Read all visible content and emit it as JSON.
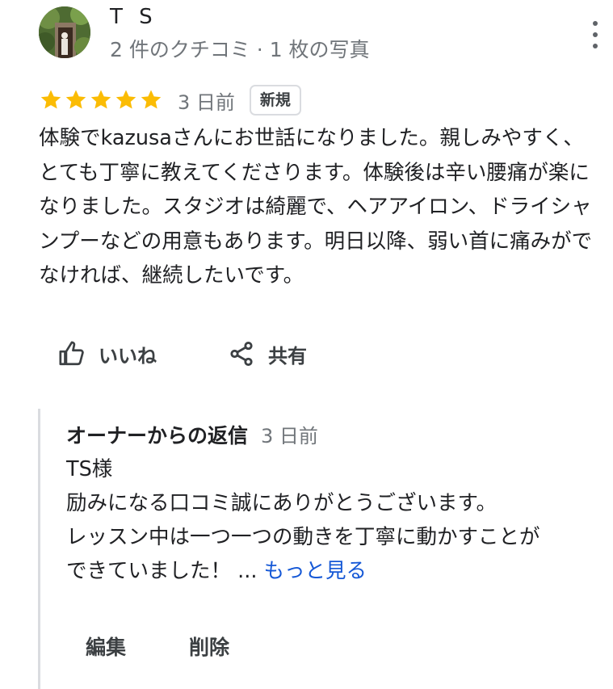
{
  "reviewer": {
    "name": "T S",
    "meta": "2 件のクチコミ · 1 枚の写真"
  },
  "rating": {
    "stars": 5,
    "max": 5,
    "star_color": "#fbbc04",
    "date": "3 日前",
    "badge": "新規"
  },
  "review": {
    "text": "体験でkazusaさんにお世話になりました。親しみやすく、とても丁寧に教えてくださります。体験後は辛い腰痛が楽になりました。スタジオは綺麗で、ヘアアイロン、ドライシャンプーなどの用意もあります。明日以降、弱い首に痛みがでなければ、継続したいです。"
  },
  "actions": {
    "like_label": "いいね",
    "share_label": "共有"
  },
  "owner_reply": {
    "title": "オーナーからの返信",
    "date": "3 日前",
    "lines": [
      "TS様",
      "励みになる口コミ誠にありがとうございます。",
      "レッスン中は一つ一つの動きを丁寧に動かすことが",
      "できていました！ ..."
    ],
    "more_label": "もっと見る",
    "edit_label": "編集",
    "delete_label": "削除"
  },
  "colors": {
    "link": "#1558d6",
    "secondary_text": "#70757a",
    "divider": "#dadce0"
  }
}
